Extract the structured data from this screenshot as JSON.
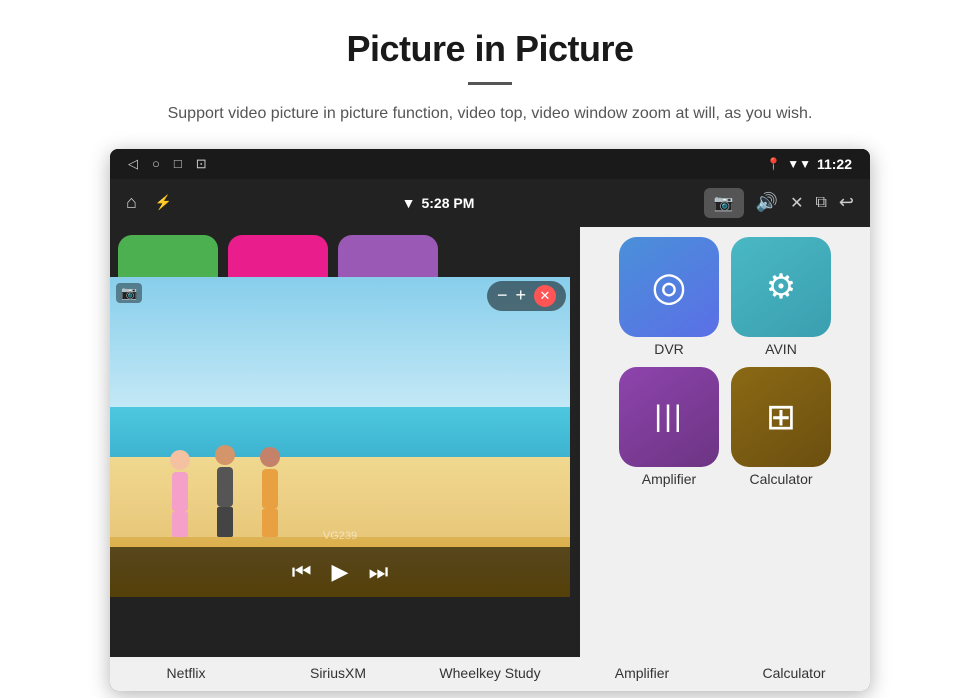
{
  "header": {
    "title": "Picture in Picture",
    "subtitle": "Support video picture in picture function, video top, video window zoom at will, as you wish."
  },
  "status_bar": {
    "time": "11:22",
    "nav_icons": [
      "◁",
      "○",
      "□",
      "⊡"
    ]
  },
  "app_bar": {
    "home_icon": "⌂",
    "usb_icon": "⚡",
    "wifi_signal": "▼",
    "time": "5:28 PM",
    "camera_icon": "📷",
    "volume_icon": "🔊",
    "close_icon": "✕",
    "pip_icon": "⧉",
    "back_icon": "↩"
  },
  "pip": {
    "minus_label": "−",
    "plus_label": "+",
    "close_label": "✕"
  },
  "playback": {
    "rewind": "⏮",
    "play": "▶",
    "forward": "⏭"
  },
  "top_apps": [
    {
      "label": "",
      "color": "green"
    },
    {
      "label": "",
      "color": "pink"
    },
    {
      "label": "",
      "color": "purple"
    }
  ],
  "app_grid": [
    {
      "id": "dvr",
      "label": "DVR",
      "symbol": "◎",
      "color_class": "blue-icon"
    },
    {
      "id": "avin",
      "label": "AVIN",
      "symbol": "⚙",
      "color_class": "teal-icon"
    },
    {
      "id": "amplifier",
      "label": "Amplifier",
      "symbol": "⫼⫼⫼",
      "color_class": "purple-icon"
    },
    {
      "id": "calculator",
      "label": "Calculator",
      "symbol": "⊞",
      "color_class": "brown-icon"
    }
  ],
  "bottom_labels": [
    {
      "id": "netflix",
      "label": "Netflix"
    },
    {
      "id": "siriusxm",
      "label": "SiriusXM"
    },
    {
      "id": "wheelkey",
      "label": "Wheelkey Study"
    },
    {
      "id": "amplifier",
      "label": "Amplifier"
    },
    {
      "id": "calculator",
      "label": "Calculator"
    }
  ],
  "watermark": "VG239"
}
